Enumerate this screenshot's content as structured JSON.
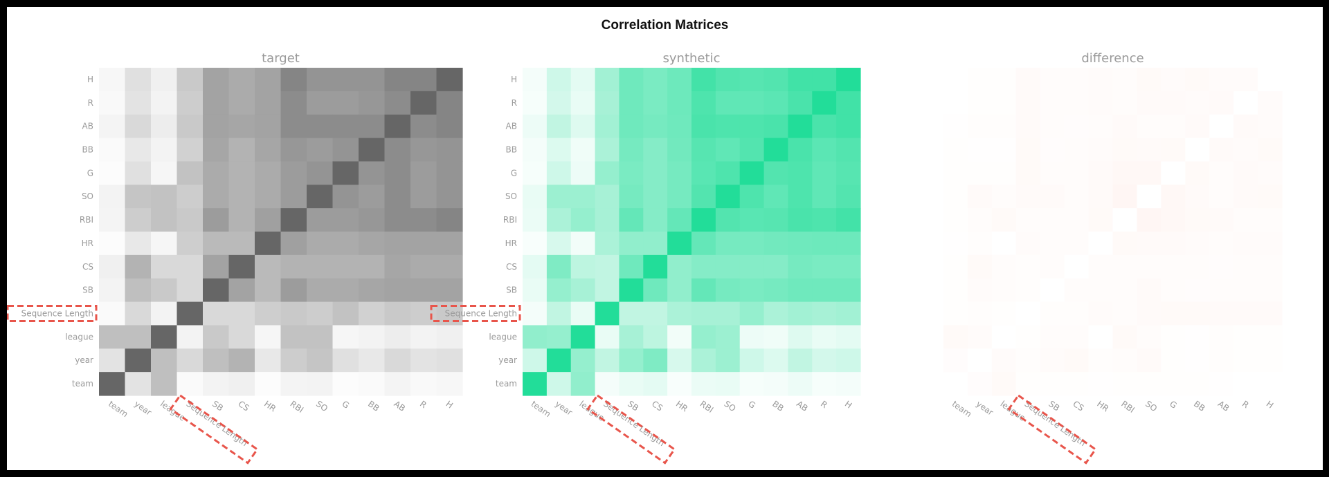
{
  "title": "Correlation Matrices",
  "chart_data": [
    {
      "type": "heatmap",
      "title": "target",
      "variables": [
        "team",
        "year",
        "league",
        "Sequence Length",
        "SB",
        "CS",
        "HR",
        "RBI",
        "SO",
        "G",
        "BB",
        "AB",
        "R",
        "H"
      ],
      "x_tick_labels": [
        "team",
        "year",
        "league",
        "Sequence Length",
        "SB",
        "CS",
        "HR",
        "RBI",
        "SO",
        "G",
        "BB",
        "AB",
        "R",
        "H"
      ],
      "y_tick_labels_top_to_bottom": [
        "H",
        "R",
        "AB",
        "BB",
        "G",
        "SO",
        "RBI",
        "HR",
        "CS",
        "SB",
        "Sequence Length",
        "league",
        "year",
        "team"
      ],
      "value_range": [
        0,
        1
      ],
      "colormap": {
        "low": "#ffffff",
        "high": "#666666"
      },
      "highlighted_label": "Sequence Length",
      "values": [
        [
          1.0,
          0.18,
          0.42,
          0.03,
          0.08,
          0.1,
          0.02,
          0.07,
          0.08,
          0.02,
          0.03,
          0.07,
          0.04,
          0.05
        ],
        [
          0.18,
          1.0,
          0.42,
          0.25,
          0.42,
          0.5,
          0.15,
          0.33,
          0.38,
          0.2,
          0.15,
          0.25,
          0.18,
          0.2
        ],
        [
          0.42,
          0.42,
          1.0,
          0.08,
          0.35,
          0.25,
          0.06,
          0.4,
          0.4,
          0.06,
          0.08,
          0.12,
          0.08,
          0.1
        ],
        [
          0.03,
          0.25,
          0.08,
          1.0,
          0.25,
          0.25,
          0.32,
          0.35,
          0.33,
          0.4,
          0.3,
          0.35,
          0.33,
          0.35
        ],
        [
          0.08,
          0.42,
          0.35,
          0.25,
          1.0,
          0.6,
          0.45,
          0.65,
          0.55,
          0.55,
          0.58,
          0.6,
          0.6,
          0.6
        ],
        [
          0.1,
          0.5,
          0.25,
          0.25,
          0.6,
          1.0,
          0.45,
          0.5,
          0.5,
          0.5,
          0.5,
          0.58,
          0.55,
          0.55
        ],
        [
          0.02,
          0.15,
          0.06,
          0.32,
          0.45,
          0.45,
          1.0,
          0.62,
          0.55,
          0.55,
          0.58,
          0.6,
          0.6,
          0.6
        ],
        [
          0.07,
          0.33,
          0.4,
          0.35,
          0.65,
          0.5,
          0.62,
          1.0,
          0.65,
          0.65,
          0.68,
          0.75,
          0.75,
          0.8
        ],
        [
          0.08,
          0.38,
          0.4,
          0.33,
          0.55,
          0.5,
          0.55,
          0.65,
          1.0,
          0.7,
          0.65,
          0.75,
          0.65,
          0.7
        ],
        [
          0.02,
          0.2,
          0.06,
          0.4,
          0.55,
          0.5,
          0.55,
          0.65,
          0.7,
          1.0,
          0.7,
          0.75,
          0.65,
          0.7
        ],
        [
          0.03,
          0.15,
          0.08,
          0.3,
          0.58,
          0.5,
          0.58,
          0.68,
          0.65,
          0.7,
          1.0,
          0.75,
          0.68,
          0.7
        ],
        [
          0.07,
          0.25,
          0.12,
          0.35,
          0.6,
          0.58,
          0.6,
          0.75,
          0.75,
          0.75,
          0.75,
          1.0,
          0.75,
          0.8
        ],
        [
          0.04,
          0.18,
          0.08,
          0.33,
          0.6,
          0.55,
          0.6,
          0.75,
          0.65,
          0.65,
          0.68,
          0.75,
          1.0,
          0.8
        ],
        [
          0.05,
          0.2,
          0.1,
          0.35,
          0.6,
          0.55,
          0.6,
          0.8,
          0.7,
          0.7,
          0.7,
          0.8,
          0.8,
          1.0
        ]
      ]
    },
    {
      "type": "heatmap",
      "title": "synthetic",
      "variables": [
        "team",
        "year",
        "league",
        "Sequence Length",
        "SB",
        "CS",
        "HR",
        "RBI",
        "SO",
        "G",
        "BB",
        "AB",
        "R",
        "H"
      ],
      "x_tick_labels": [
        "team",
        "year",
        "league",
        "Sequence Length",
        "SB",
        "CS",
        "HR",
        "RBI",
        "SO",
        "G",
        "BB",
        "AB",
        "R",
        "H"
      ],
      "y_tick_labels_top_to_bottom": [
        "H",
        "R",
        "AB",
        "BB",
        "G",
        "SO",
        "RBI",
        "HR",
        "CS",
        "SB",
        "Sequence Length",
        "league",
        "year",
        "team"
      ],
      "value_range": [
        0,
        1
      ],
      "colormap": {
        "low": "#ffffff",
        "high": "#22dd99"
      },
      "highlighted_label": "Sequence Length",
      "values": [
        [
          1.0,
          0.22,
          0.5,
          0.05,
          0.1,
          0.12,
          0.03,
          0.09,
          0.1,
          0.04,
          0.05,
          0.08,
          0.04,
          0.05
        ],
        [
          0.22,
          1.0,
          0.48,
          0.28,
          0.48,
          0.58,
          0.18,
          0.38,
          0.45,
          0.22,
          0.16,
          0.28,
          0.2,
          0.22
        ],
        [
          0.5,
          0.48,
          1.0,
          0.1,
          0.4,
          0.3,
          0.06,
          0.48,
          0.45,
          0.08,
          0.07,
          0.15,
          0.1,
          0.12
        ],
        [
          0.05,
          0.28,
          0.1,
          1.0,
          0.28,
          0.28,
          0.38,
          0.4,
          0.4,
          0.48,
          0.38,
          0.42,
          0.4,
          0.42
        ],
        [
          0.1,
          0.48,
          0.4,
          0.28,
          1.0,
          0.65,
          0.5,
          0.7,
          0.62,
          0.6,
          0.62,
          0.65,
          0.65,
          0.65
        ],
        [
          0.12,
          0.58,
          0.3,
          0.28,
          0.65,
          1.0,
          0.5,
          0.55,
          0.55,
          0.55,
          0.55,
          0.62,
          0.6,
          0.6
        ],
        [
          0.03,
          0.18,
          0.06,
          0.38,
          0.5,
          0.5,
          1.0,
          0.7,
          0.62,
          0.62,
          0.64,
          0.65,
          0.66,
          0.66
        ],
        [
          0.09,
          0.38,
          0.48,
          0.4,
          0.7,
          0.55,
          0.7,
          1.0,
          0.78,
          0.75,
          0.76,
          0.82,
          0.8,
          0.85
        ],
        [
          0.1,
          0.45,
          0.45,
          0.4,
          0.62,
          0.55,
          0.62,
          0.78,
          1.0,
          0.8,
          0.72,
          0.8,
          0.72,
          0.78
        ],
        [
          0.04,
          0.22,
          0.08,
          0.48,
          0.6,
          0.55,
          0.62,
          0.75,
          0.8,
          1.0,
          0.78,
          0.8,
          0.72,
          0.76
        ],
        [
          0.05,
          0.16,
          0.07,
          0.38,
          0.62,
          0.55,
          0.64,
          0.76,
          0.72,
          0.78,
          1.0,
          0.82,
          0.74,
          0.78
        ],
        [
          0.08,
          0.28,
          0.15,
          0.42,
          0.65,
          0.62,
          0.65,
          0.82,
          0.8,
          0.8,
          0.82,
          1.0,
          0.82,
          0.86
        ],
        [
          0.04,
          0.2,
          0.1,
          0.4,
          0.65,
          0.6,
          0.66,
          0.8,
          0.72,
          0.72,
          0.74,
          0.82,
          1.0,
          0.86
        ],
        [
          0.05,
          0.22,
          0.12,
          0.42,
          0.65,
          0.6,
          0.66,
          0.85,
          0.78,
          0.76,
          0.78,
          0.86,
          0.86,
          1.0
        ]
      ]
    },
    {
      "type": "heatmap",
      "title": "difference",
      "variables": [
        "team",
        "year",
        "league",
        "Sequence Length",
        "SB",
        "CS",
        "HR",
        "RBI",
        "SO",
        "G",
        "BB",
        "AB",
        "R",
        "H"
      ],
      "x_tick_labels": [
        "team",
        "year",
        "league",
        "Sequence Length",
        "SB",
        "CS",
        "HR",
        "RBI",
        "SO",
        "G",
        "BB",
        "AB",
        "R",
        "H"
      ],
      "y_tick_labels_top_to_bottom": [
        "",
        "",
        "",
        "",
        "",
        "",
        "",
        "",
        "",
        "",
        "",
        "",
        "",
        ""
      ],
      "value_range": [
        0,
        1
      ],
      "colormap": {
        "low": "#ffffff",
        "high": "#ff6a3d"
      },
      "highlighted_label": "Sequence Length",
      "values": [
        [
          0.0,
          0.04,
          0.08,
          0.02,
          0.02,
          0.02,
          0.01,
          0.02,
          0.02,
          0.02,
          0.02,
          0.01,
          0.0,
          0.0
        ],
        [
          0.04,
          0.0,
          0.06,
          0.03,
          0.06,
          0.08,
          0.03,
          0.05,
          0.07,
          0.02,
          0.01,
          0.03,
          0.02,
          0.02
        ],
        [
          0.08,
          0.06,
          0.0,
          0.02,
          0.05,
          0.05,
          0.0,
          0.08,
          0.05,
          0.02,
          0.01,
          0.03,
          0.02,
          0.02
        ],
        [
          0.02,
          0.03,
          0.02,
          0.0,
          0.03,
          0.03,
          0.06,
          0.05,
          0.07,
          0.08,
          0.08,
          0.07,
          0.07,
          0.07
        ],
        [
          0.02,
          0.06,
          0.05,
          0.03,
          0.0,
          0.05,
          0.05,
          0.05,
          0.07,
          0.05,
          0.04,
          0.05,
          0.05,
          0.05
        ],
        [
          0.02,
          0.08,
          0.05,
          0.03,
          0.05,
          0.0,
          0.05,
          0.05,
          0.05,
          0.05,
          0.05,
          0.04,
          0.05,
          0.05
        ],
        [
          0.01,
          0.03,
          0.0,
          0.06,
          0.05,
          0.05,
          0.0,
          0.08,
          0.07,
          0.07,
          0.06,
          0.05,
          0.06,
          0.06
        ],
        [
          0.02,
          0.05,
          0.08,
          0.05,
          0.05,
          0.05,
          0.08,
          0.0,
          0.13,
          0.1,
          0.08,
          0.07,
          0.05,
          0.05
        ],
        [
          0.02,
          0.07,
          0.05,
          0.07,
          0.07,
          0.05,
          0.07,
          0.13,
          0.0,
          0.1,
          0.07,
          0.05,
          0.07,
          0.08
        ],
        [
          0.02,
          0.02,
          0.02,
          0.08,
          0.05,
          0.05,
          0.07,
          0.1,
          0.1,
          0.0,
          0.08,
          0.05,
          0.07,
          0.06
        ],
        [
          0.02,
          0.01,
          0.01,
          0.08,
          0.04,
          0.05,
          0.06,
          0.08,
          0.07,
          0.08,
          0.0,
          0.07,
          0.06,
          0.08
        ],
        [
          0.01,
          0.03,
          0.03,
          0.07,
          0.05,
          0.04,
          0.05,
          0.07,
          0.05,
          0.05,
          0.07,
          0.0,
          0.07,
          0.06
        ],
        [
          0.0,
          0.02,
          0.02,
          0.07,
          0.05,
          0.05,
          0.06,
          0.05,
          0.07,
          0.07,
          0.06,
          0.07,
          0.0,
          0.06
        ],
        [
          0.0,
          0.02,
          0.02,
          0.07,
          0.05,
          0.05,
          0.06,
          0.05,
          0.08,
          0.06,
          0.08,
          0.06,
          0.06,
          0.0
        ]
      ]
    }
  ]
}
